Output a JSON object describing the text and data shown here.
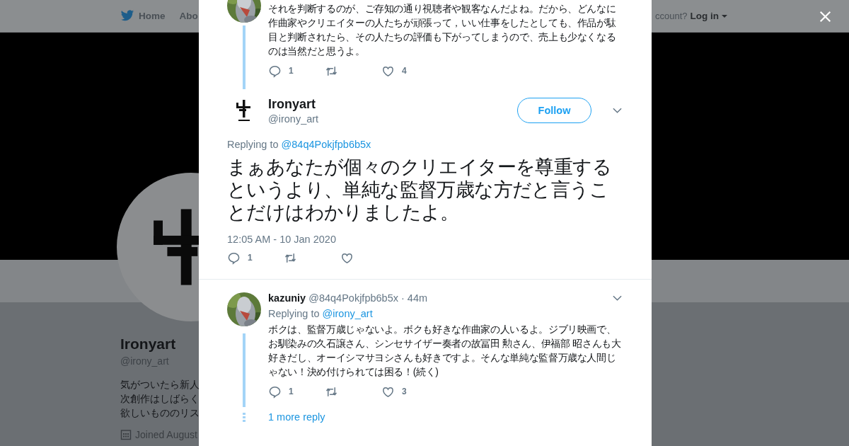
{
  "background": {
    "nav": {
      "home": "Home",
      "about": "Abo",
      "account_prompt": "ccount?",
      "login": "Log in"
    },
    "profile": {
      "name": "Ironyart",
      "handle": "@irony_art",
      "bio_lines": [
        "気がついたら新人",
        "次創作はしばらく",
        "欲しいもののリス"
      ],
      "joined": "Joined August"
    }
  },
  "modal": {
    "previous_tweet": {
      "text": "それを判断するのが、ご存知の通り視聴者や観客なんだよね。だから、どんなに作曲家やクリエイターの人たちが頑張って，いい仕事をしたとしても、作品が駄目と判断されたら、その人たちの評価も下がってしまうので、売上も少なくなるのは当然だと思うよ。",
      "actions": [
        {
          "kind": "reply",
          "count": "1"
        },
        {
          "kind": "retweet"
        },
        {
          "kind": "like",
          "count": "4"
        }
      ]
    },
    "main_tweet": {
      "name": "Ironyart",
      "handle": "@irony_art",
      "follow": "Follow",
      "replying_label": "Replying to",
      "replying_to": "@84q4Pokjfpb6b5x",
      "text": "まぁあなたが個々のクリエイターを尊重するというより、単純な監督万歳な方だと言うことだけはわかりましたよ。",
      "timestamp": "12:05 AM - 10 Jan 2020",
      "actions": [
        {
          "kind": "reply",
          "count": "1"
        },
        {
          "kind": "retweet"
        },
        {
          "kind": "like"
        }
      ]
    },
    "reply_tweet": {
      "name": "kazuniy",
      "handle": "@84q4Pokjfpb6b5x",
      "time": "· 44m",
      "replying_label": "Replying to",
      "replying_to": "@irony_art",
      "text": "ボクは、監督万歳じゃないよ。ボクも好きな作曲家の人いるよ。ジブリ映画で、お馴染みの久石譲さん、シンセサイザー奏者の故冨田 勲さん、伊福部 昭さんも大好きだし、オーイシマサヨシさんも好きですよ。そんな単純な監督万歳な人間じゃない！決め付けられては困る！(続く)",
      "actions": [
        {
          "kind": "reply",
          "count": "1"
        },
        {
          "kind": "retweet"
        },
        {
          "kind": "like",
          "count": "3"
        }
      ],
      "more_replies": "1 more reply"
    }
  }
}
